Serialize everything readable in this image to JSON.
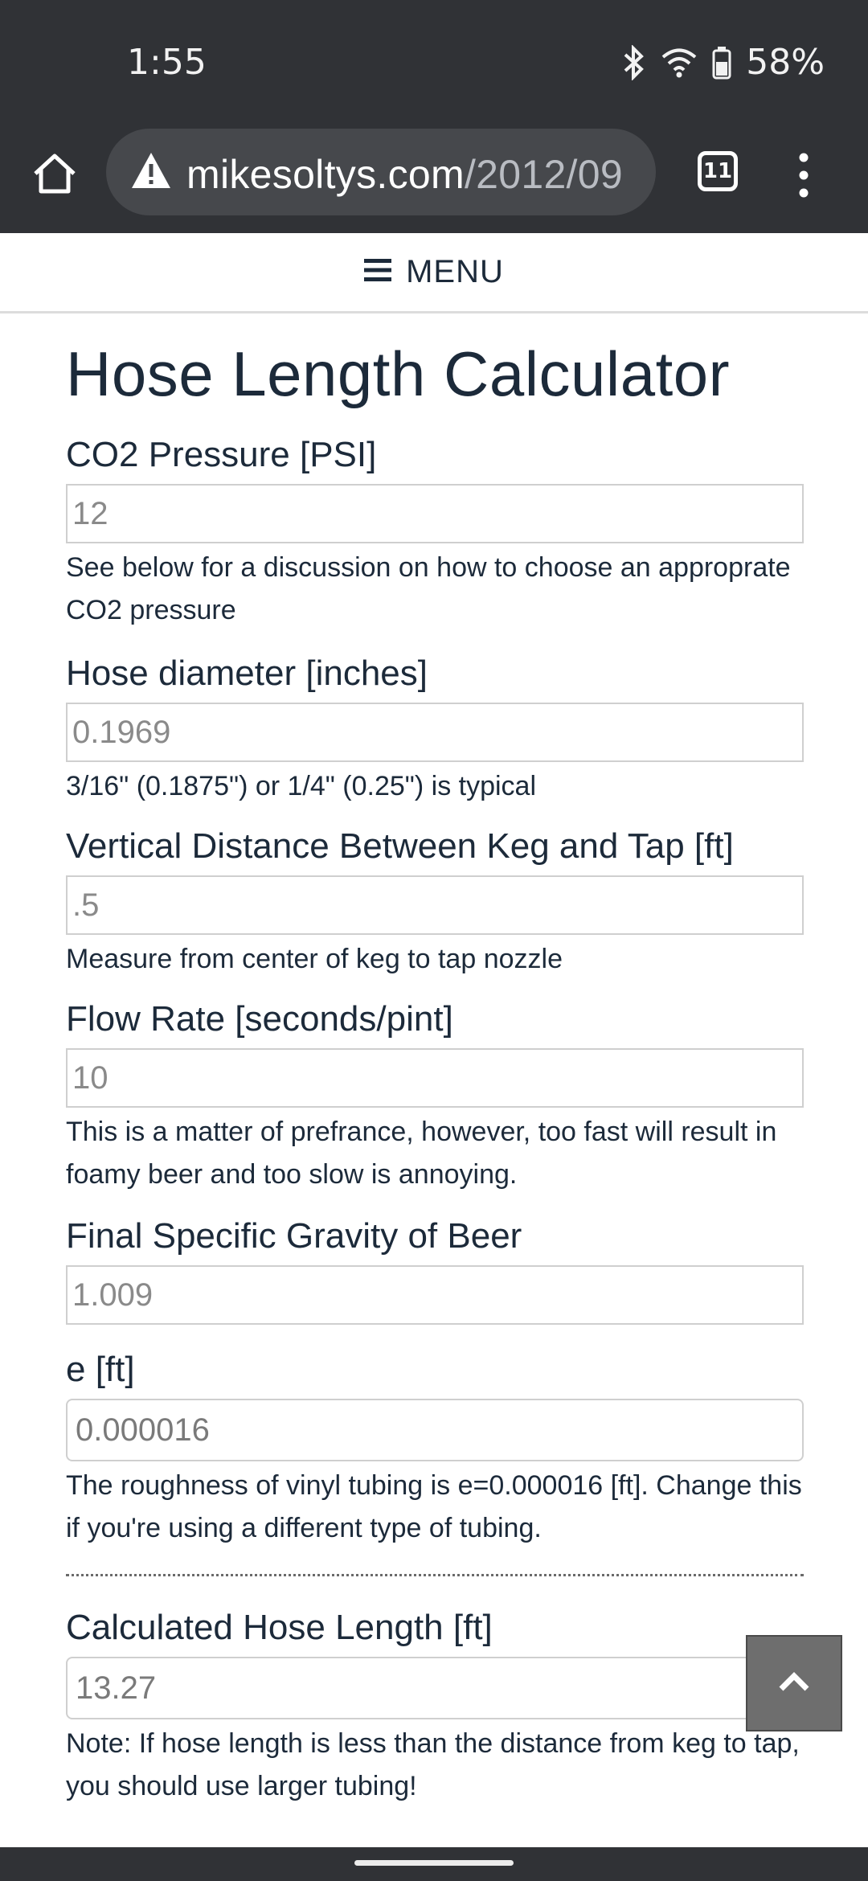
{
  "status": {
    "time": "1:55",
    "battery": "58%"
  },
  "browser": {
    "url_host": "mikesoltys.com",
    "url_path": "/2012/09",
    "tab_count": "11"
  },
  "menu": {
    "label": "MENU"
  },
  "page": {
    "title": "Hose Length Calculator"
  },
  "fields": [
    {
      "label": "CO2 Pressure [PSI]",
      "value": "12",
      "help": "See below for a discussion on how to choose an approprate CO2 pressure"
    },
    {
      "label": "Hose diameter [inches]",
      "value": "0.1969",
      "help": "3/16\" (0.1875\") or 1/4\" (0.25\") is typical"
    },
    {
      "label": "Vertical Distance Between Keg and Tap [ft]",
      "value": ".5",
      "help": "Measure from center of keg to tap nozzle"
    },
    {
      "label": "Flow Rate [seconds/pint]",
      "value": "10",
      "help": "This is a matter of prefrance, however, too fast will result in foamy beer and too slow is annoying."
    },
    {
      "label": "Final Specific Gravity of Beer",
      "value": "1.009"
    },
    {
      "label": "e [ft]",
      "value": "0.000016",
      "help": "The roughness of vinyl tubing is e=0.000016 [ft]. Change this if you're using a different type of tubing."
    }
  ],
  "result": {
    "label": "Calculated Hose Length [ft]",
    "value": "13.27",
    "help": "Note: If hose length is less than the distance from keg to tap, you should use larger tubing!"
  }
}
